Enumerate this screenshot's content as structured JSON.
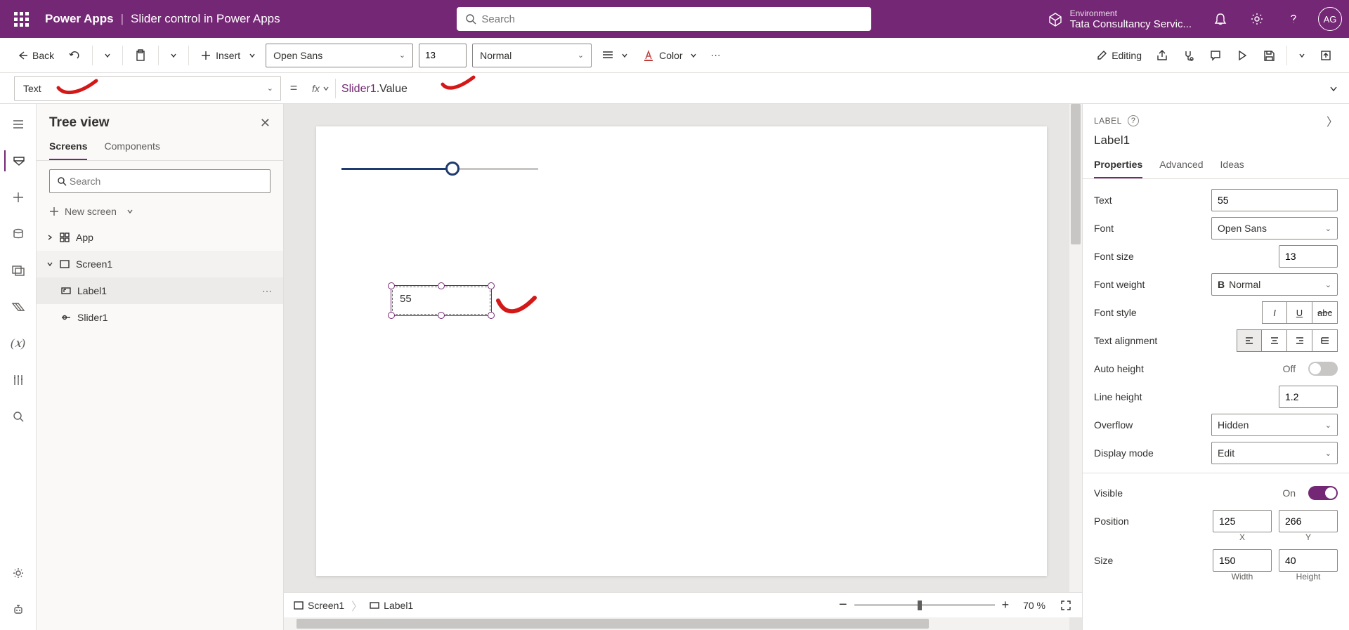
{
  "header": {
    "app_name": "Power Apps",
    "page_title": "Slider control in Power Apps",
    "search_placeholder": "Search",
    "env_label": "Environment",
    "env_name": "Tata Consultancy Servic...",
    "avatar_initials": "AG"
  },
  "ribbon": {
    "back": "Back",
    "insert": "Insert",
    "font": "Open Sans",
    "font_size": "13",
    "weight": "Normal",
    "color": "Color",
    "mode": "Editing"
  },
  "formula": {
    "property": "Text",
    "fx": "fx",
    "tok_obj": "Slider1",
    "tok_rest": ".Value"
  },
  "tree": {
    "title": "Tree view",
    "tab_screens": "Screens",
    "tab_components": "Components",
    "search_placeholder": "Search",
    "new_screen": "New screen",
    "items": {
      "app": "App",
      "screen1": "Screen1",
      "label1": "Label1",
      "slider1": "Slider1"
    }
  },
  "canvas": {
    "label_value": "55"
  },
  "breadcrumb": {
    "screen": "Screen1",
    "control": "Label1",
    "zoom": "70  %"
  },
  "props": {
    "type": "LABEL",
    "name": "Label1",
    "tabs": {
      "properties": "Properties",
      "advanced": "Advanced",
      "ideas": "Ideas"
    },
    "rows": {
      "text_label": "Text",
      "text_val": "55",
      "font_label": "Font",
      "font_val": "Open Sans",
      "fontsize_label": "Font size",
      "fontsize_val": "13",
      "fontweight_label": "Font weight",
      "fontweight_val": "Normal",
      "fontstyle_label": "Font style",
      "align_label": "Text alignment",
      "autoh_label": "Auto height",
      "autoh_val": "Off",
      "lineh_label": "Line height",
      "lineh_val": "1.2",
      "overflow_label": "Overflow",
      "overflow_val": "Hidden",
      "display_label": "Display mode",
      "display_val": "Edit",
      "visible_label": "Visible",
      "visible_val": "On",
      "position_label": "Position",
      "pos_x": "125",
      "pos_y": "266",
      "x_lbl": "X",
      "y_lbl": "Y",
      "size_label": "Size",
      "size_w": "150",
      "size_h": "40",
      "w_lbl": "Width",
      "h_lbl": "Height"
    }
  }
}
